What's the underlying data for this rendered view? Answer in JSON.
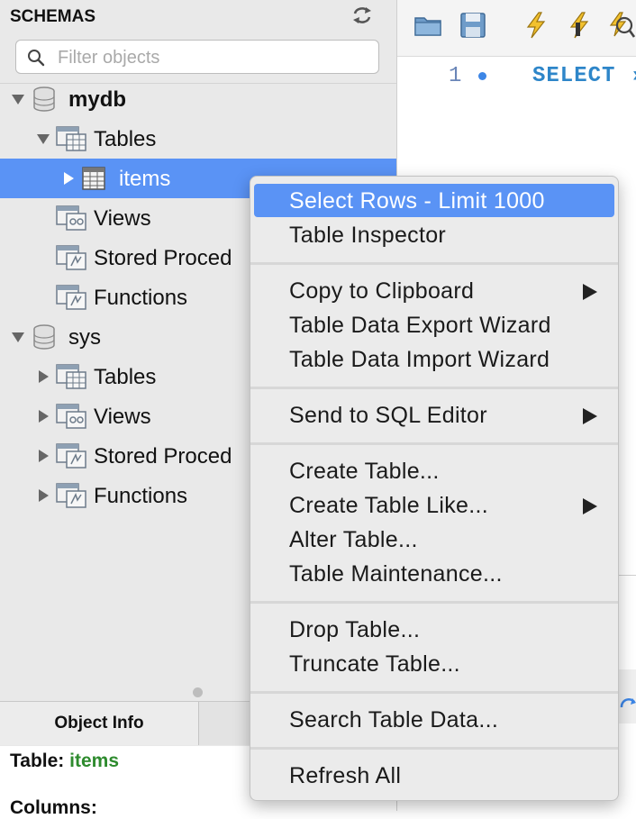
{
  "schemas_panel": {
    "title": "SCHEMAS",
    "filter_placeholder": "Filter objects",
    "tree": [
      {
        "label": "mydb",
        "type": "schema",
        "expanded": true
      },
      {
        "label": "Tables",
        "type": "folder",
        "expanded": true
      },
      {
        "label": "items",
        "type": "table",
        "selected": true
      },
      {
        "label": "Views",
        "type": "folder"
      },
      {
        "label": "Stored Proced",
        "type": "folder"
      },
      {
        "label": "Functions",
        "type": "folder"
      },
      {
        "label": "sys",
        "type": "schema",
        "expanded": true
      },
      {
        "label": "Tables",
        "type": "folder",
        "expanded": false
      },
      {
        "label": "Views",
        "type": "folder",
        "expanded": false
      },
      {
        "label": "Stored Proced",
        "type": "folder",
        "expanded": false
      },
      {
        "label": "Functions",
        "type": "folder",
        "expanded": false
      }
    ]
  },
  "bottom_tabs": [
    {
      "label": "Object Info",
      "active": true
    },
    {
      "label": "",
      "active": false
    }
  ],
  "object_info": {
    "table_label": "Table:",
    "table_value": "items",
    "columns_label": "Columns:"
  },
  "editor": {
    "line_number": "1",
    "sql_text": "SELECT ›"
  },
  "context_menu": {
    "groups": [
      [
        {
          "label": "Select Rows - Limit 1000",
          "highlighted": true
        },
        {
          "label": "Table Inspector"
        }
      ],
      [
        {
          "label": "Copy to Clipboard",
          "submenu": true
        },
        {
          "label": "Table Data Export Wizard"
        },
        {
          "label": "Table Data Import Wizard"
        }
      ],
      [
        {
          "label": "Send to SQL Editor",
          "submenu": true
        }
      ],
      [
        {
          "label": "Create Table..."
        },
        {
          "label": "Create Table Like...",
          "submenu": true
        },
        {
          "label": "Alter Table..."
        },
        {
          "label": "Table Maintenance..."
        }
      ],
      [
        {
          "label": "Drop Table..."
        },
        {
          "label": "Truncate Table..."
        }
      ],
      [
        {
          "label": "Search Table Data..."
        }
      ],
      [
        {
          "label": "Refresh All"
        }
      ]
    ]
  },
  "colors": {
    "selection": "#5a93f5",
    "sql_keyword": "#2e86c9",
    "info_value": "#2e8b2e"
  }
}
